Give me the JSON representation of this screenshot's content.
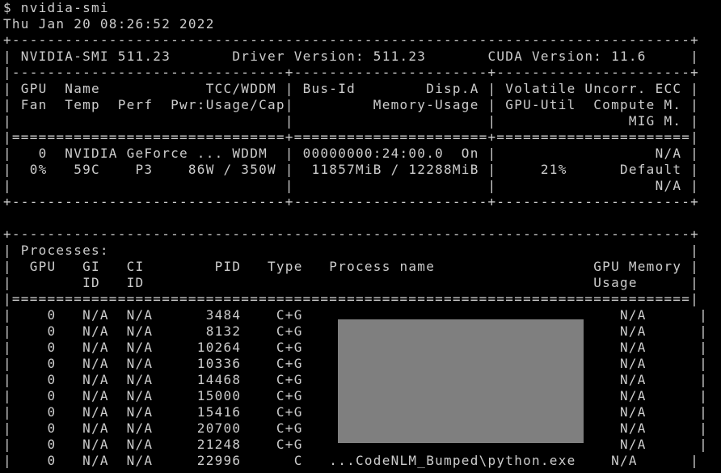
{
  "colors": {
    "background": "#000000",
    "text": "#cccccc",
    "redaction": "#7f7f7f"
  },
  "terminal": {
    "lines": [
      "$ nvidia-smi",
      "Thu Jan 20 08:26:52 2022",
      "+-----------------------------------------------------------------------------+",
      "| NVIDIA-SMI 511.23       Driver Version: 511.23       CUDA Version: 11.6     |",
      "|-------------------------------+----------------------+----------------------+",
      "| GPU  Name            TCC/WDDM | Bus-Id        Disp.A | Volatile Uncorr. ECC |",
      "| Fan  Temp  Perf  Pwr:Usage/Cap|         Memory-Usage | GPU-Util  Compute M. |",
      "|                               |                      |               MIG M. |",
      "|===============================+======================+======================|",
      "|   0  NVIDIA GeForce ... WDDM  | 00000000:24:00.0  On |                  N/A |",
      "|  0%   59C    P3    86W / 350W |  11857MiB / 12288MiB |     21%      Default |",
      "|                               |                      |                  N/A |",
      "+-------------------------------+----------------------+----------------------+",
      "",
      "+-----------------------------------------------------------------------------+",
      "| Processes:                                                                  |",
      "|  GPU   GI   CI        PID   Type   Process name                  GPU Memory |",
      "|        ID   ID                                                   Usage      |",
      "|=============================================================================|",
      "|    0   N/A  N/A      3484    C+G                                    N/A      |",
      "|    0   N/A  N/A      8132    C+G                                    N/A      |",
      "|    0   N/A  N/A     10264    C+G                                    N/A      |",
      "|    0   N/A  N/A     10336    C+G                                    N/A      |",
      "|    0   N/A  N/A     14468    C+G                                    N/A      |",
      "|    0   N/A  N/A     15000    C+G                                    N/A      |",
      "|    0   N/A  N/A     15416    C+G                                    N/A      |",
      "|    0   N/A  N/A     20700    C+G                                    N/A      |",
      "|    0   N/A  N/A     21248    C+G                                    N/A      |",
      "|    0   N/A  N/A     22996      C   ...CodeNLM_Bumped\\python.exe    N/A      |"
    ]
  }
}
